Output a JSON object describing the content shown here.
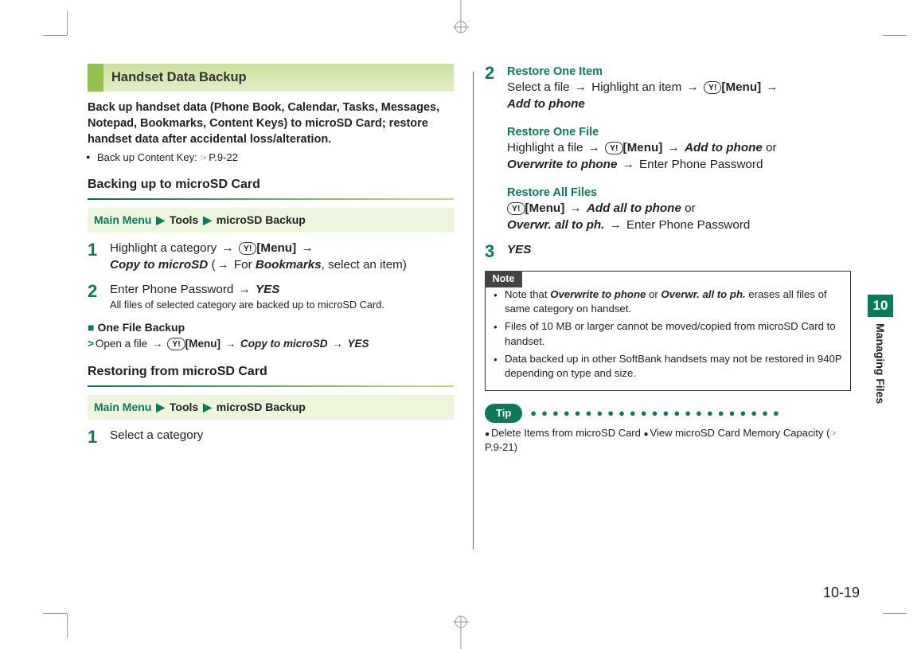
{
  "side_tab": {
    "chapter_num": "10",
    "chapter_title": "Managing Files"
  },
  "page_number": "10-19",
  "left": {
    "heading": "Handset Data Backup",
    "intro": "Back up handset data (Phone Book, Calendar, Tasks, Messages, Notepad, Bookmarks, Content Keys) to microSD Card; restore handset data after accidental loss/alteration.",
    "intro_bullet_prefix": "Back up Content Key: ",
    "intro_bullet_ref": "P.9-22",
    "sub1": "Backing up to microSD Card",
    "menu_path1_a": "Main Menu",
    "menu_path1_b": "Tools",
    "menu_path1_c": "microSD Backup",
    "step1_a": "Highlight a category ",
    "step1_key": "Y!",
    "step1_b": "[Menu]",
    "step1_copy": "Copy to microSD",
    "step1_for": " For ",
    "step1_bookmarks": "Bookmarks",
    "step1_suffix": ", select an item)",
    "step2_a": "Enter Phone Password ",
    "step2_yes": "YES",
    "step2_note": "All files of selected category are backed up to microSD Card.",
    "onefile_head": "One File Backup",
    "onefile_a": "Open a file ",
    "onefile_key": "Y!",
    "onefile_b": "[Menu]",
    "onefile_copy": "Copy to microSD",
    "onefile_yes": "YES",
    "sub2": "Restoring from microSD Card",
    "menu_path2_a": "Main Menu",
    "menu_path2_b": "Tools",
    "menu_path2_c": "microSD Backup",
    "step_r1": "Select a category"
  },
  "right": {
    "item_label": "Restore One Item",
    "item_a": "Select a file ",
    "item_b": " Highlight an item ",
    "item_key": "Y!",
    "item_menu": "[Menu]",
    "item_add": "Add to phone",
    "file_label": "Restore One File",
    "file_a": "Highlight a file ",
    "file_key": "Y!",
    "file_menu": "[Menu]",
    "file_add": "Add to phone",
    "file_or": " or ",
    "file_ovr": "Overwrite to phone",
    "file_suffix": " Enter Phone Password",
    "all_label": "Restore All Files",
    "all_key": "Y!",
    "all_menu": "[Menu]",
    "all_add": "Add all to phone",
    "all_or": " or ",
    "all_ovr": "Overwr. all to ph.",
    "all_suffix": " Enter Phone Password",
    "step3": "YES",
    "note_label": "Note",
    "note1_a": "Note that ",
    "note1_b": "Overwrite to phone",
    "note1_c": " or ",
    "note1_d": "Overwr. all to ph.",
    "note1_e": " erases all files of same category on handset.",
    "note2": "Files of 10 MB or larger cannot be moved/copied from microSD Card to handset.",
    "note3": "Data backed up in other SoftBank handsets may not be restored in 940P depending on type and size.",
    "tip_label": "Tip",
    "tip1": "Delete Items from microSD Card ",
    "tip2": "View microSD Card Memory Capacity (",
    "tip_ref": "P.9-21",
    "tip_close": ")"
  }
}
